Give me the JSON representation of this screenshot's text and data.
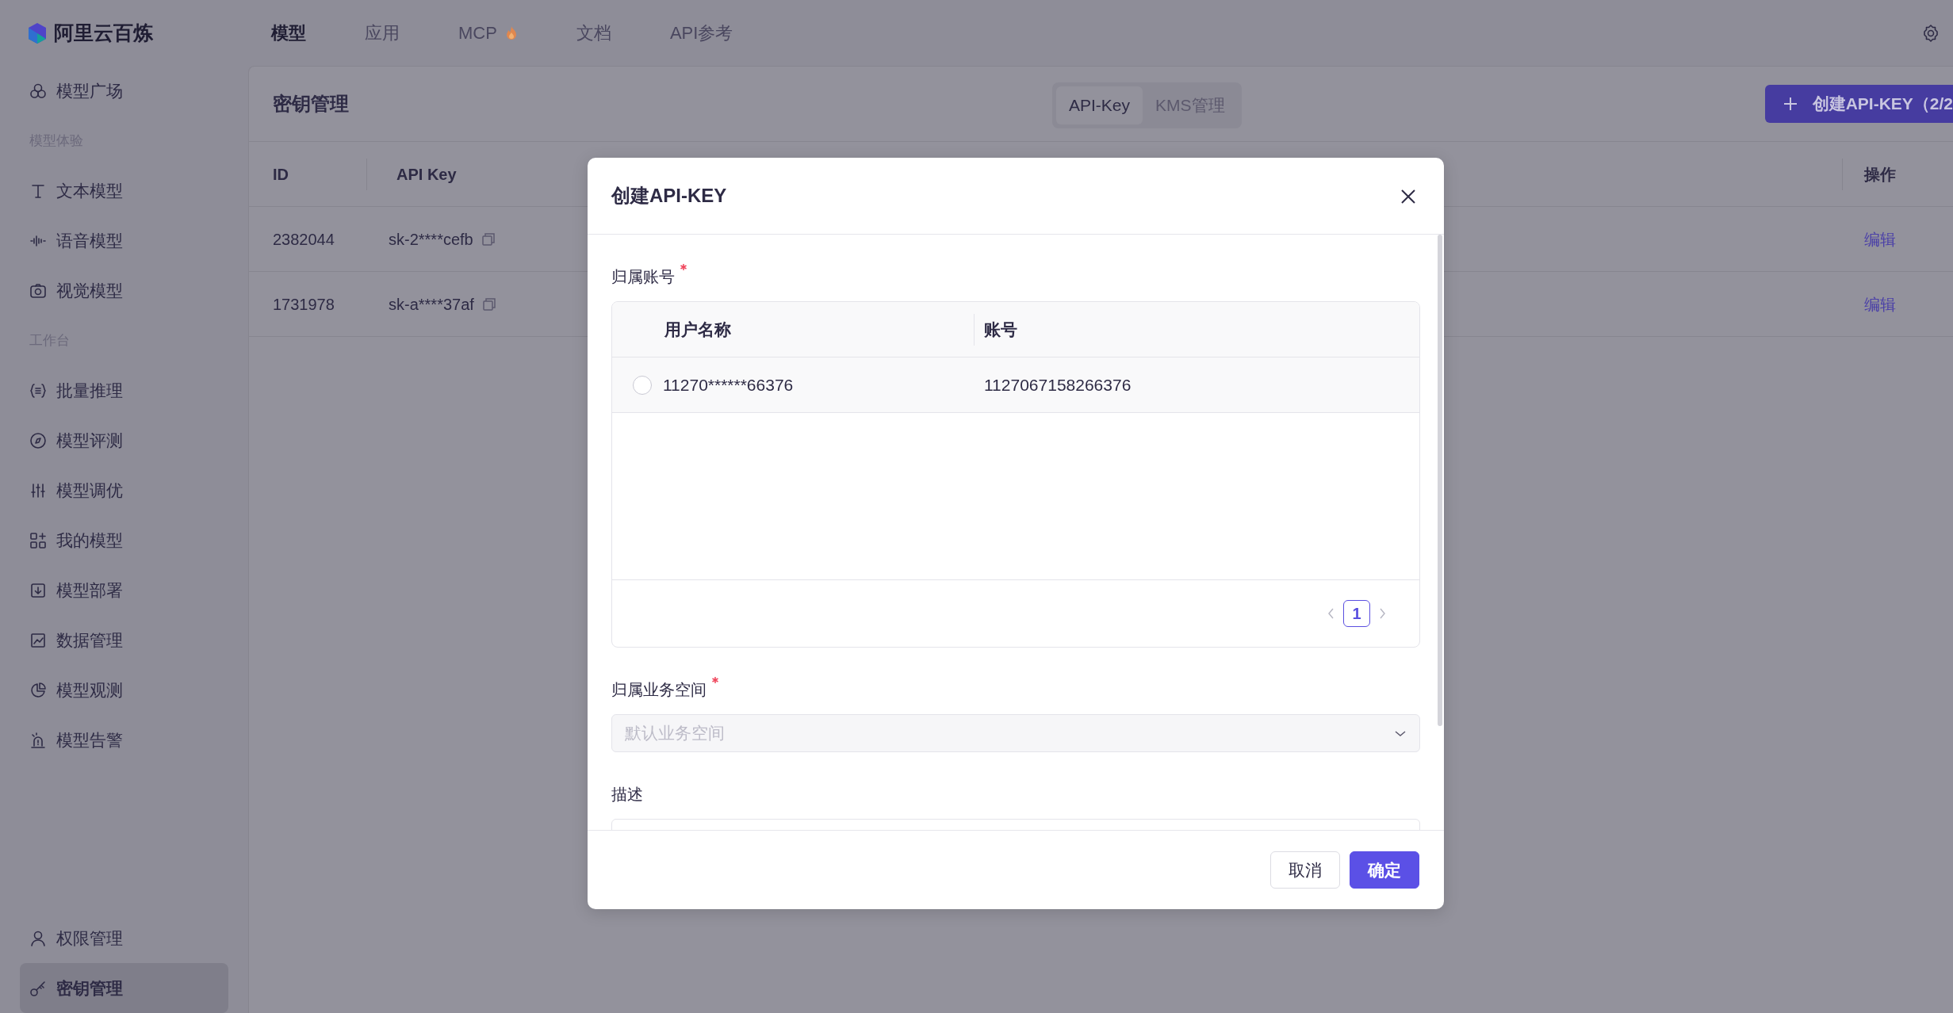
{
  "app": {
    "logo_text": "阿里云百炼"
  },
  "top_nav": [
    {
      "label": "模型",
      "selected": true,
      "hot": false
    },
    {
      "label": "应用",
      "selected": false,
      "hot": false
    },
    {
      "label": "MCP",
      "selected": false,
      "hot": true
    },
    {
      "label": "文档",
      "selected": false,
      "hot": false
    },
    {
      "label": "API参考",
      "selected": false,
      "hot": false
    }
  ],
  "sidebar": {
    "items": [
      {
        "kind": "item",
        "label": "模型广场",
        "selected": false
      },
      {
        "kind": "section",
        "label": "模型体验"
      },
      {
        "kind": "item",
        "label": "文本模型",
        "selected": false
      },
      {
        "kind": "item",
        "label": "语音模型",
        "selected": false
      },
      {
        "kind": "item",
        "label": "视觉模型",
        "selected": false
      },
      {
        "kind": "section",
        "label": "工作台"
      },
      {
        "kind": "item",
        "label": "批量推理",
        "selected": false
      },
      {
        "kind": "item",
        "label": "模型评测",
        "selected": false
      },
      {
        "kind": "item",
        "label": "模型调优",
        "selected": false
      },
      {
        "kind": "item",
        "label": "我的模型",
        "selected": false
      },
      {
        "kind": "item",
        "label": "模型部署",
        "selected": false
      },
      {
        "kind": "item",
        "label": "数据管理",
        "selected": false
      },
      {
        "kind": "item",
        "label": "模型观测",
        "selected": false
      },
      {
        "kind": "item",
        "label": "模型告警",
        "selected": false
      },
      {
        "kind": "spacer"
      },
      {
        "kind": "item",
        "label": "权限管理",
        "selected": false
      },
      {
        "kind": "item",
        "label": "密钥管理",
        "selected": true
      }
    ]
  },
  "page": {
    "title": "密钥管理",
    "segments": [
      {
        "label": "API-Key",
        "selected": true
      },
      {
        "label": "KMS管理",
        "selected": false
      }
    ],
    "create_button": "创建API-KEY（2/2"
  },
  "table": {
    "columns": [
      "ID",
      "API Key",
      "操作"
    ],
    "rows": [
      {
        "id": "2382044",
        "api_key": "sk-2****cefb",
        "action": "编辑"
      },
      {
        "id": "1731978",
        "api_key": "sk-a****37af",
        "action": "编辑"
      }
    ]
  },
  "dialog": {
    "title": "创建API-KEY",
    "account_label": "归属账号",
    "account_required": true,
    "account_table": {
      "columns": [
        "用户名称",
        "账号"
      ],
      "rows": [
        {
          "name": "11270******66376",
          "account": "1127067158266376",
          "selected": false
        }
      ]
    },
    "pagination": {
      "pages": [
        {
          "label": "1",
          "selected": true
        }
      ]
    },
    "workspace_label": "归属业务空间",
    "workspace_required": true,
    "workspace_select": {
      "placeholder": "默认业务空间",
      "disabled": true
    },
    "description_label": "描述",
    "buttons": [
      {
        "label": "取消",
        "kind": "secondary"
      },
      {
        "label": "确定",
        "kind": "primary"
      }
    ]
  }
}
